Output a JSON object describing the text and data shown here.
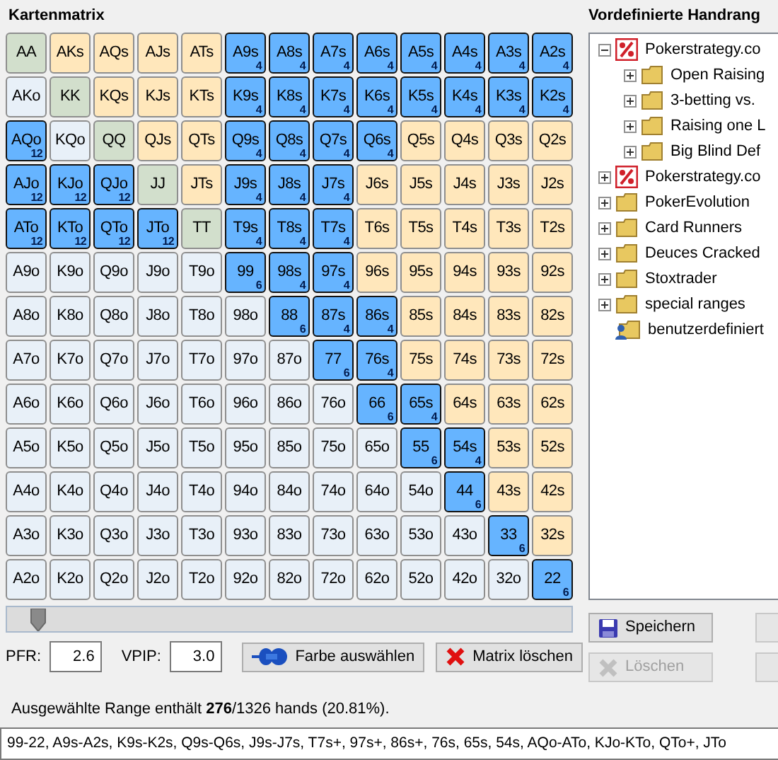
{
  "matrix": {
    "title": "Kartenmatrix",
    "rows": [
      [
        {
          "label": "AA",
          "kind": "pair",
          "selected": false
        },
        {
          "label": "AKs",
          "kind": "suited",
          "selected": false
        },
        {
          "label": "AQs",
          "kind": "suited",
          "selected": false
        },
        {
          "label": "AJs",
          "kind": "suited",
          "selected": false
        },
        {
          "label": "ATs",
          "kind": "suited",
          "selected": false
        },
        {
          "label": "A9s",
          "kind": "suited",
          "selected": true,
          "combos": "4"
        },
        {
          "label": "A8s",
          "kind": "suited",
          "selected": true,
          "combos": "4"
        },
        {
          "label": "A7s",
          "kind": "suited",
          "selected": true,
          "combos": "4"
        },
        {
          "label": "A6s",
          "kind": "suited",
          "selected": true,
          "combos": "4"
        },
        {
          "label": "A5s",
          "kind": "suited",
          "selected": true,
          "combos": "4"
        },
        {
          "label": "A4s",
          "kind": "suited",
          "selected": true,
          "combos": "4"
        },
        {
          "label": "A3s",
          "kind": "suited",
          "selected": true,
          "combos": "4"
        },
        {
          "label": "A2s",
          "kind": "suited",
          "selected": true,
          "combos": "4"
        }
      ],
      [
        {
          "label": "AKo",
          "kind": "offsuit",
          "selected": false
        },
        {
          "label": "KK",
          "kind": "pair",
          "selected": false
        },
        {
          "label": "KQs",
          "kind": "suited",
          "selected": false
        },
        {
          "label": "KJs",
          "kind": "suited",
          "selected": false
        },
        {
          "label": "KTs",
          "kind": "suited",
          "selected": false
        },
        {
          "label": "K9s",
          "kind": "suited",
          "selected": true,
          "combos": "4"
        },
        {
          "label": "K8s",
          "kind": "suited",
          "selected": true,
          "combos": "4"
        },
        {
          "label": "K7s",
          "kind": "suited",
          "selected": true,
          "combos": "4"
        },
        {
          "label": "K6s",
          "kind": "suited",
          "selected": true,
          "combos": "4"
        },
        {
          "label": "K5s",
          "kind": "suited",
          "selected": true,
          "combos": "4"
        },
        {
          "label": "K4s",
          "kind": "suited",
          "selected": true,
          "combos": "4"
        },
        {
          "label": "K3s",
          "kind": "suited",
          "selected": true,
          "combos": "4"
        },
        {
          "label": "K2s",
          "kind": "suited",
          "selected": true,
          "combos": "4"
        }
      ],
      [
        {
          "label": "AQo",
          "kind": "offsuit",
          "selected": true,
          "combos": "12"
        },
        {
          "label": "KQo",
          "kind": "offsuit",
          "selected": false
        },
        {
          "label": "QQ",
          "kind": "pair",
          "selected": false
        },
        {
          "label": "QJs",
          "kind": "suited",
          "selected": false
        },
        {
          "label": "QTs",
          "kind": "suited",
          "selected": false
        },
        {
          "label": "Q9s",
          "kind": "suited",
          "selected": true,
          "combos": "4"
        },
        {
          "label": "Q8s",
          "kind": "suited",
          "selected": true,
          "combos": "4"
        },
        {
          "label": "Q7s",
          "kind": "suited",
          "selected": true,
          "combos": "4"
        },
        {
          "label": "Q6s",
          "kind": "suited",
          "selected": true,
          "combos": "4"
        },
        {
          "label": "Q5s",
          "kind": "suited",
          "selected": false
        },
        {
          "label": "Q4s",
          "kind": "suited",
          "selected": false
        },
        {
          "label": "Q3s",
          "kind": "suited",
          "selected": false
        },
        {
          "label": "Q2s",
          "kind": "suited",
          "selected": false
        }
      ],
      [
        {
          "label": "AJo",
          "kind": "offsuit",
          "selected": true,
          "combos": "12"
        },
        {
          "label": "KJo",
          "kind": "offsuit",
          "selected": true,
          "combos": "12"
        },
        {
          "label": "QJo",
          "kind": "offsuit",
          "selected": true,
          "combos": "12"
        },
        {
          "label": "JJ",
          "kind": "pair",
          "selected": false
        },
        {
          "label": "JTs",
          "kind": "suited",
          "selected": false
        },
        {
          "label": "J9s",
          "kind": "suited",
          "selected": true,
          "combos": "4"
        },
        {
          "label": "J8s",
          "kind": "suited",
          "selected": true,
          "combos": "4"
        },
        {
          "label": "J7s",
          "kind": "suited",
          "selected": true,
          "combos": "4"
        },
        {
          "label": "J6s",
          "kind": "suited",
          "selected": false
        },
        {
          "label": "J5s",
          "kind": "suited",
          "selected": false
        },
        {
          "label": "J4s",
          "kind": "suited",
          "selected": false
        },
        {
          "label": "J3s",
          "kind": "suited",
          "selected": false
        },
        {
          "label": "J2s",
          "kind": "suited",
          "selected": false
        }
      ],
      [
        {
          "label": "ATo",
          "kind": "offsuit",
          "selected": true,
          "combos": "12"
        },
        {
          "label": "KTo",
          "kind": "offsuit",
          "selected": true,
          "combos": "12"
        },
        {
          "label": "QTo",
          "kind": "offsuit",
          "selected": true,
          "combos": "12"
        },
        {
          "label": "JTo",
          "kind": "offsuit",
          "selected": true,
          "combos": "12"
        },
        {
          "label": "TT",
          "kind": "pair",
          "selected": false
        },
        {
          "label": "T9s",
          "kind": "suited",
          "selected": true,
          "combos": "4"
        },
        {
          "label": "T8s",
          "kind": "suited",
          "selected": true,
          "combos": "4"
        },
        {
          "label": "T7s",
          "kind": "suited",
          "selected": true,
          "combos": "4"
        },
        {
          "label": "T6s",
          "kind": "suited",
          "selected": false
        },
        {
          "label": "T5s",
          "kind": "suited",
          "selected": false
        },
        {
          "label": "T4s",
          "kind": "suited",
          "selected": false
        },
        {
          "label": "T3s",
          "kind": "suited",
          "selected": false
        },
        {
          "label": "T2s",
          "kind": "suited",
          "selected": false
        }
      ],
      [
        {
          "label": "A9o",
          "kind": "offsuit",
          "selected": false
        },
        {
          "label": "K9o",
          "kind": "offsuit",
          "selected": false
        },
        {
          "label": "Q9o",
          "kind": "offsuit",
          "selected": false
        },
        {
          "label": "J9o",
          "kind": "offsuit",
          "selected": false
        },
        {
          "label": "T9o",
          "kind": "offsuit",
          "selected": false
        },
        {
          "label": "99",
          "kind": "pair",
          "selected": true,
          "combos": "6"
        },
        {
          "label": "98s",
          "kind": "suited",
          "selected": true,
          "combos": "4"
        },
        {
          "label": "97s",
          "kind": "suited",
          "selected": true,
          "combos": "4"
        },
        {
          "label": "96s",
          "kind": "suited",
          "selected": false
        },
        {
          "label": "95s",
          "kind": "suited",
          "selected": false
        },
        {
          "label": "94s",
          "kind": "suited",
          "selected": false
        },
        {
          "label": "93s",
          "kind": "suited",
          "selected": false
        },
        {
          "label": "92s",
          "kind": "suited",
          "selected": false
        }
      ],
      [
        {
          "label": "A8o",
          "kind": "offsuit",
          "selected": false
        },
        {
          "label": "K8o",
          "kind": "offsuit",
          "selected": false
        },
        {
          "label": "Q8o",
          "kind": "offsuit",
          "selected": false
        },
        {
          "label": "J8o",
          "kind": "offsuit",
          "selected": false
        },
        {
          "label": "T8o",
          "kind": "offsuit",
          "selected": false
        },
        {
          "label": "98o",
          "kind": "offsuit",
          "selected": false
        },
        {
          "label": "88",
          "kind": "pair",
          "selected": true,
          "combos": "6"
        },
        {
          "label": "87s",
          "kind": "suited",
          "selected": true,
          "combos": "4"
        },
        {
          "label": "86s",
          "kind": "suited",
          "selected": true,
          "combos": "4"
        },
        {
          "label": "85s",
          "kind": "suited",
          "selected": false
        },
        {
          "label": "84s",
          "kind": "suited",
          "selected": false
        },
        {
          "label": "83s",
          "kind": "suited",
          "selected": false
        },
        {
          "label": "82s",
          "kind": "suited",
          "selected": false
        }
      ],
      [
        {
          "label": "A7o",
          "kind": "offsuit",
          "selected": false
        },
        {
          "label": "K7o",
          "kind": "offsuit",
          "selected": false
        },
        {
          "label": "Q7o",
          "kind": "offsuit",
          "selected": false
        },
        {
          "label": "J7o",
          "kind": "offsuit",
          "selected": false
        },
        {
          "label": "T7o",
          "kind": "offsuit",
          "selected": false
        },
        {
          "label": "97o",
          "kind": "offsuit",
          "selected": false
        },
        {
          "label": "87o",
          "kind": "offsuit",
          "selected": false
        },
        {
          "label": "77",
          "kind": "pair",
          "selected": true,
          "combos": "6"
        },
        {
          "label": "76s",
          "kind": "suited",
          "selected": true,
          "combos": "4"
        },
        {
          "label": "75s",
          "kind": "suited",
          "selected": false
        },
        {
          "label": "74s",
          "kind": "suited",
          "selected": false
        },
        {
          "label": "73s",
          "kind": "suited",
          "selected": false
        },
        {
          "label": "72s",
          "kind": "suited",
          "selected": false
        }
      ],
      [
        {
          "label": "A6o",
          "kind": "offsuit",
          "selected": false
        },
        {
          "label": "K6o",
          "kind": "offsuit",
          "selected": false
        },
        {
          "label": "Q6o",
          "kind": "offsuit",
          "selected": false
        },
        {
          "label": "J6o",
          "kind": "offsuit",
          "selected": false
        },
        {
          "label": "T6o",
          "kind": "offsuit",
          "selected": false
        },
        {
          "label": "96o",
          "kind": "offsuit",
          "selected": false
        },
        {
          "label": "86o",
          "kind": "offsuit",
          "selected": false
        },
        {
          "label": "76o",
          "kind": "offsuit",
          "selected": false
        },
        {
          "label": "66",
          "kind": "pair",
          "selected": true,
          "combos": "6"
        },
        {
          "label": "65s",
          "kind": "suited",
          "selected": true,
          "combos": "4"
        },
        {
          "label": "64s",
          "kind": "suited",
          "selected": false
        },
        {
          "label": "63s",
          "kind": "suited",
          "selected": false
        },
        {
          "label": "62s",
          "kind": "suited",
          "selected": false
        }
      ],
      [
        {
          "label": "A5o",
          "kind": "offsuit",
          "selected": false
        },
        {
          "label": "K5o",
          "kind": "offsuit",
          "selected": false
        },
        {
          "label": "Q5o",
          "kind": "offsuit",
          "selected": false
        },
        {
          "label": "J5o",
          "kind": "offsuit",
          "selected": false
        },
        {
          "label": "T5o",
          "kind": "offsuit",
          "selected": false
        },
        {
          "label": "95o",
          "kind": "offsuit",
          "selected": false
        },
        {
          "label": "85o",
          "kind": "offsuit",
          "selected": false
        },
        {
          "label": "75o",
          "kind": "offsuit",
          "selected": false
        },
        {
          "label": "65o",
          "kind": "offsuit",
          "selected": false
        },
        {
          "label": "55",
          "kind": "pair",
          "selected": true,
          "combos": "6"
        },
        {
          "label": "54s",
          "kind": "suited",
          "selected": true,
          "combos": "4"
        },
        {
          "label": "53s",
          "kind": "suited",
          "selected": false
        },
        {
          "label": "52s",
          "kind": "suited",
          "selected": false
        }
      ],
      [
        {
          "label": "A4o",
          "kind": "offsuit",
          "selected": false
        },
        {
          "label": "K4o",
          "kind": "offsuit",
          "selected": false
        },
        {
          "label": "Q4o",
          "kind": "offsuit",
          "selected": false
        },
        {
          "label": "J4o",
          "kind": "offsuit",
          "selected": false
        },
        {
          "label": "T4o",
          "kind": "offsuit",
          "selected": false
        },
        {
          "label": "94o",
          "kind": "offsuit",
          "selected": false
        },
        {
          "label": "84o",
          "kind": "offsuit",
          "selected": false
        },
        {
          "label": "74o",
          "kind": "offsuit",
          "selected": false
        },
        {
          "label": "64o",
          "kind": "offsuit",
          "selected": false
        },
        {
          "label": "54o",
          "kind": "offsuit",
          "selected": false
        },
        {
          "label": "44",
          "kind": "pair",
          "selected": true,
          "combos": "6"
        },
        {
          "label": "43s",
          "kind": "suited",
          "selected": false
        },
        {
          "label": "42s",
          "kind": "suited",
          "selected": false
        }
      ],
      [
        {
          "label": "A3o",
          "kind": "offsuit",
          "selected": false
        },
        {
          "label": "K3o",
          "kind": "offsuit",
          "selected": false
        },
        {
          "label": "Q3o",
          "kind": "offsuit",
          "selected": false
        },
        {
          "label": "J3o",
          "kind": "offsuit",
          "selected": false
        },
        {
          "label": "T3o",
          "kind": "offsuit",
          "selected": false
        },
        {
          "label": "93o",
          "kind": "offsuit",
          "selected": false
        },
        {
          "label": "83o",
          "kind": "offsuit",
          "selected": false
        },
        {
          "label": "73o",
          "kind": "offsuit",
          "selected": false
        },
        {
          "label": "63o",
          "kind": "offsuit",
          "selected": false
        },
        {
          "label": "53o",
          "kind": "offsuit",
          "selected": false
        },
        {
          "label": "43o",
          "kind": "offsuit",
          "selected": false
        },
        {
          "label": "33",
          "kind": "pair",
          "selected": true,
          "combos": "6"
        },
        {
          "label": "32s",
          "kind": "suited",
          "selected": false
        }
      ],
      [
        {
          "label": "A2o",
          "kind": "offsuit",
          "selected": false
        },
        {
          "label": "K2o",
          "kind": "offsuit",
          "selected": false
        },
        {
          "label": "Q2o",
          "kind": "offsuit",
          "selected": false
        },
        {
          "label": "J2o",
          "kind": "offsuit",
          "selected": false
        },
        {
          "label": "T2o",
          "kind": "offsuit",
          "selected": false
        },
        {
          "label": "92o",
          "kind": "offsuit",
          "selected": false
        },
        {
          "label": "82o",
          "kind": "offsuit",
          "selected": false
        },
        {
          "label": "72o",
          "kind": "offsuit",
          "selected": false
        },
        {
          "label": "62o",
          "kind": "offsuit",
          "selected": false
        },
        {
          "label": "52o",
          "kind": "offsuit",
          "selected": false
        },
        {
          "label": "42o",
          "kind": "offsuit",
          "selected": false
        },
        {
          "label": "32o",
          "kind": "offsuit",
          "selected": false
        },
        {
          "label": "22",
          "kind": "pair",
          "selected": true,
          "combos": "6"
        }
      ]
    ]
  },
  "slider": {
    "level": 0.04
  },
  "pfr": {
    "label": "PFR:",
    "value": "2.6"
  },
  "vpip": {
    "label": "VPIP:",
    "value": "3.0"
  },
  "buttons": [
    {
      "kind": "color",
      "label": "Farbe auswählen",
      "disabled": false
    },
    {
      "kind": "clear",
      "label": "Matrix löschen",
      "disabled": false
    }
  ],
  "summary": "Ausgewählte Range enthält **276**/1326 hands (20.81%).",
  "range_text": "99-22, A9s-A2s, K9s-K2s, Q9s-Q6s, J9s-J7s, T7s+, 97s+, 86s+, 76s, 65s, 54s, AQo-ATo, KJo-KTo, QTo+, JTo",
  "predefined": {
    "title": "Vordefinierte Handrang",
    "tree": [
      {
        "label": "Pokerstrategy.co",
        "kind": "strategy",
        "expanded": true,
        "children": [
          {
            "label": "Open Raising",
            "kind": "folder",
            "expanded": false
          },
          {
            "label": "3-betting vs.",
            "kind": "folder",
            "expanded": false
          },
          {
            "label": "Raising one L",
            "kind": "folder",
            "expanded": false
          },
          {
            "label": "Big Blind Def",
            "kind": "folder",
            "expanded": false
          }
        ]
      },
      {
        "label": "Pokerstrategy.co",
        "kind": "strategy",
        "expanded": false
      },
      {
        "label": "PokerEvolution",
        "kind": "folder",
        "expanded": false
      },
      {
        "label": "Card Runners",
        "kind": "folder",
        "expanded": false
      },
      {
        "label": "Deuces Cracked",
        "kind": "folder",
        "expanded": false
      },
      {
        "label": "Stoxtrader",
        "kind": "folder",
        "expanded": false
      },
      {
        "label": "special ranges",
        "kind": "folder",
        "expanded": false
      },
      {
        "label": "benutzerdefiniert",
        "kind": "user"
      }
    ],
    "buttons": [
      {
        "kind": "save",
        "label": "Speichern",
        "disabled": false
      },
      {
        "kind": "delete",
        "label": "Löschen",
        "disabled": true
      }
    ],
    "side_buttons": [
      {
        "disabled": true
      },
      {
        "disabled": true
      }
    ]
  }
}
